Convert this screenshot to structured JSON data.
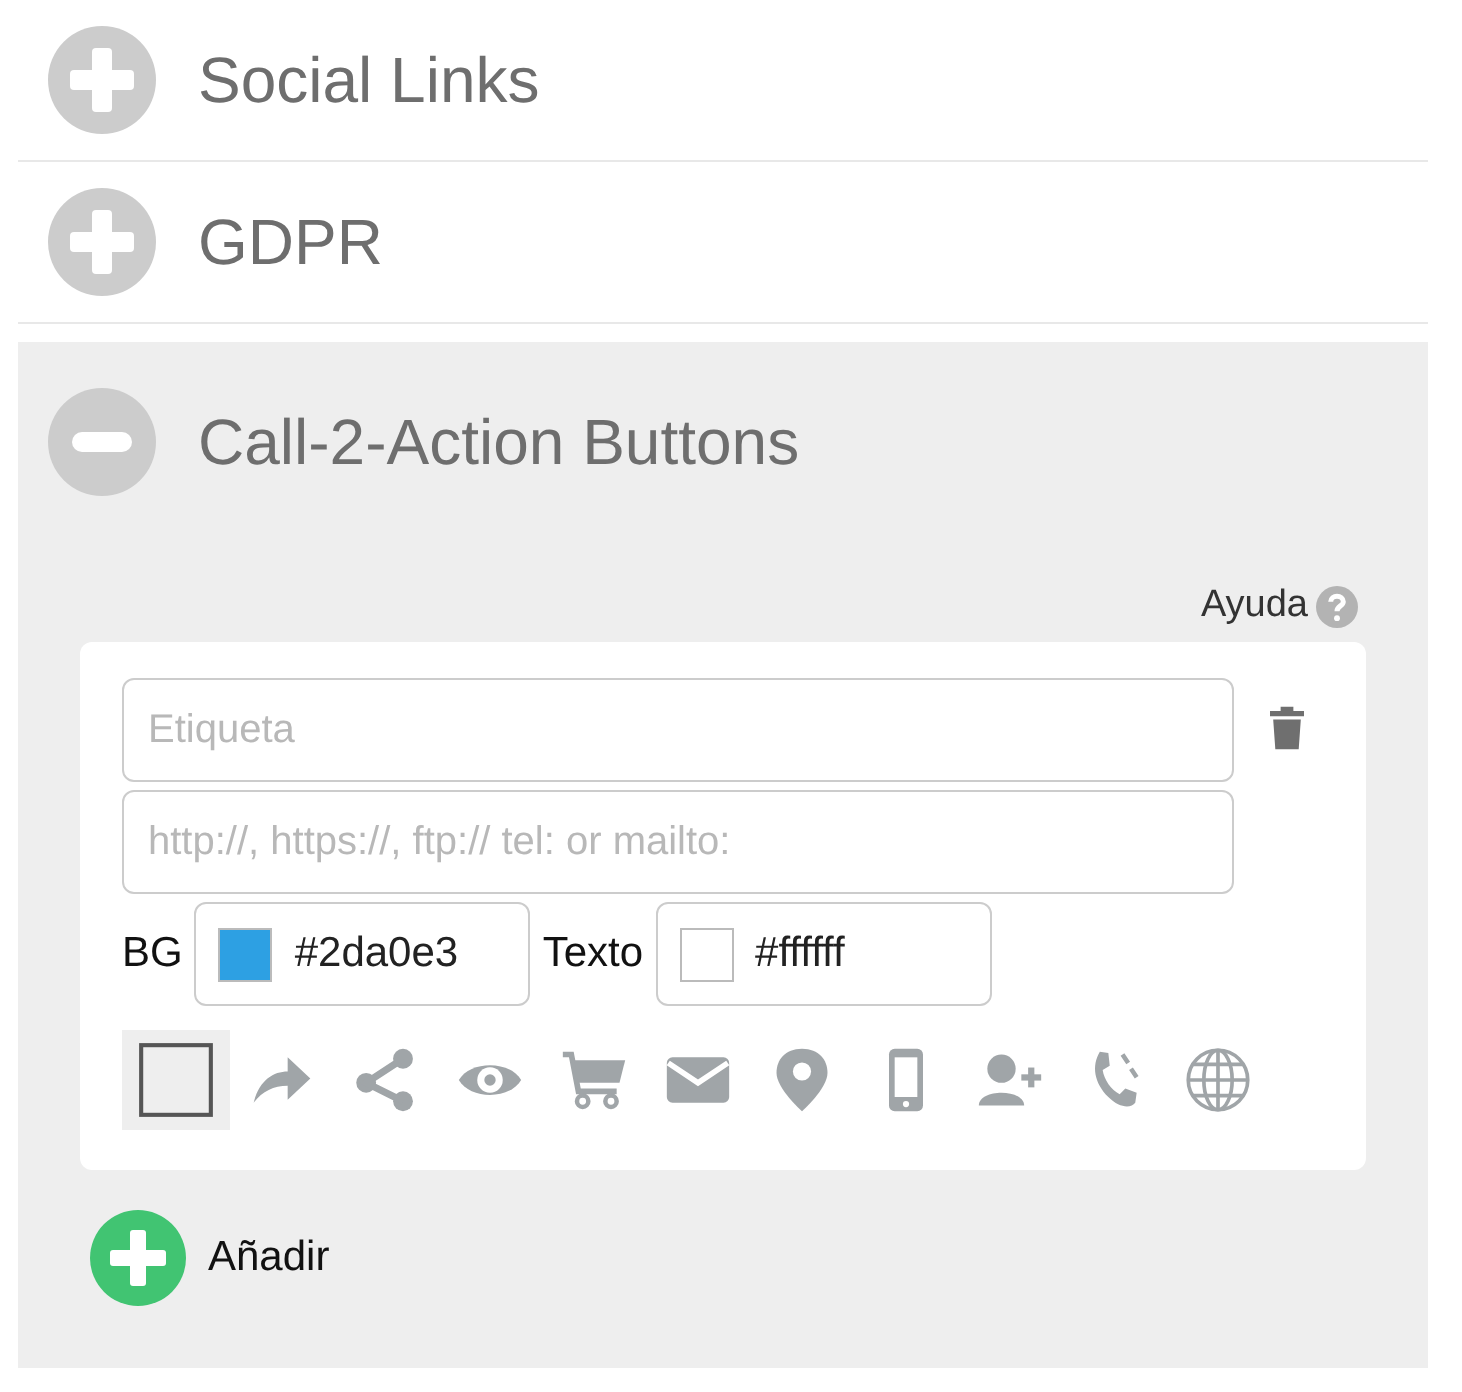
{
  "sections": [
    {
      "title": "Social Links",
      "expanded": false
    },
    {
      "title": "GDPR",
      "expanded": false
    },
    {
      "title": "Call-2-Action Buttons",
      "expanded": true
    }
  ],
  "help": {
    "label": "Ayuda"
  },
  "button_item": {
    "label_field": {
      "placeholder": "Etiqueta"
    },
    "url_field": {
      "placeholder": "http://, https://, ftp:// tel: or mailto:"
    },
    "bg": {
      "label": "BG",
      "value": "#2da0e3",
      "color": "#2da0e3"
    },
    "text": {
      "label": "Texto",
      "value": "#ffffff",
      "color": "#ffffff"
    },
    "icons": [
      {
        "kind": "none",
        "selected": true
      },
      {
        "kind": "arrow",
        "selected": false
      },
      {
        "kind": "share",
        "selected": false
      },
      {
        "kind": "eye",
        "selected": false
      },
      {
        "kind": "cart",
        "selected": false
      },
      {
        "kind": "envelope",
        "selected": false
      },
      {
        "kind": "pin",
        "selected": false
      },
      {
        "kind": "phone",
        "selected": false
      },
      {
        "kind": "user-plus",
        "selected": false
      },
      {
        "kind": "handset",
        "selected": false
      },
      {
        "kind": "globe",
        "selected": false
      }
    ]
  },
  "add_button": {
    "label": "Añadir"
  }
}
